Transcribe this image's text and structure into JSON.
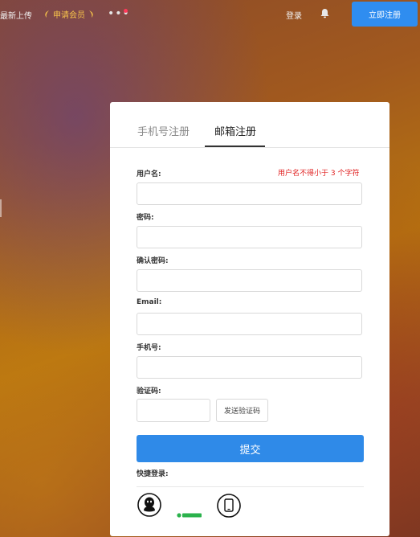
{
  "topbar": {
    "latest_upload": "最新上传",
    "vip": "申请会员",
    "more": "•••",
    "login": "登录",
    "register_now": "立即注册"
  },
  "tabs": [
    {
      "label": "手机号注册",
      "active": false
    },
    {
      "label": "邮箱注册",
      "active": true
    }
  ],
  "form": {
    "username_label": "用户名:",
    "username_hint": "用户名不得小于 3 个字符",
    "password_label": "密码:",
    "confirm_password_label": "确认密码:",
    "email_label": "Email:",
    "phone_label": "手机号:",
    "code_label": "验证码:",
    "send_code": "发送验证码",
    "submit": "提交",
    "quick_login": "快捷登录:"
  },
  "colors": {
    "accent": "#2f8ae8",
    "error": "#e02020",
    "vip": "#f6c24a"
  },
  "quick_login_icons": [
    "qq-icon",
    "wechat-icon",
    "tablet-icon"
  ]
}
